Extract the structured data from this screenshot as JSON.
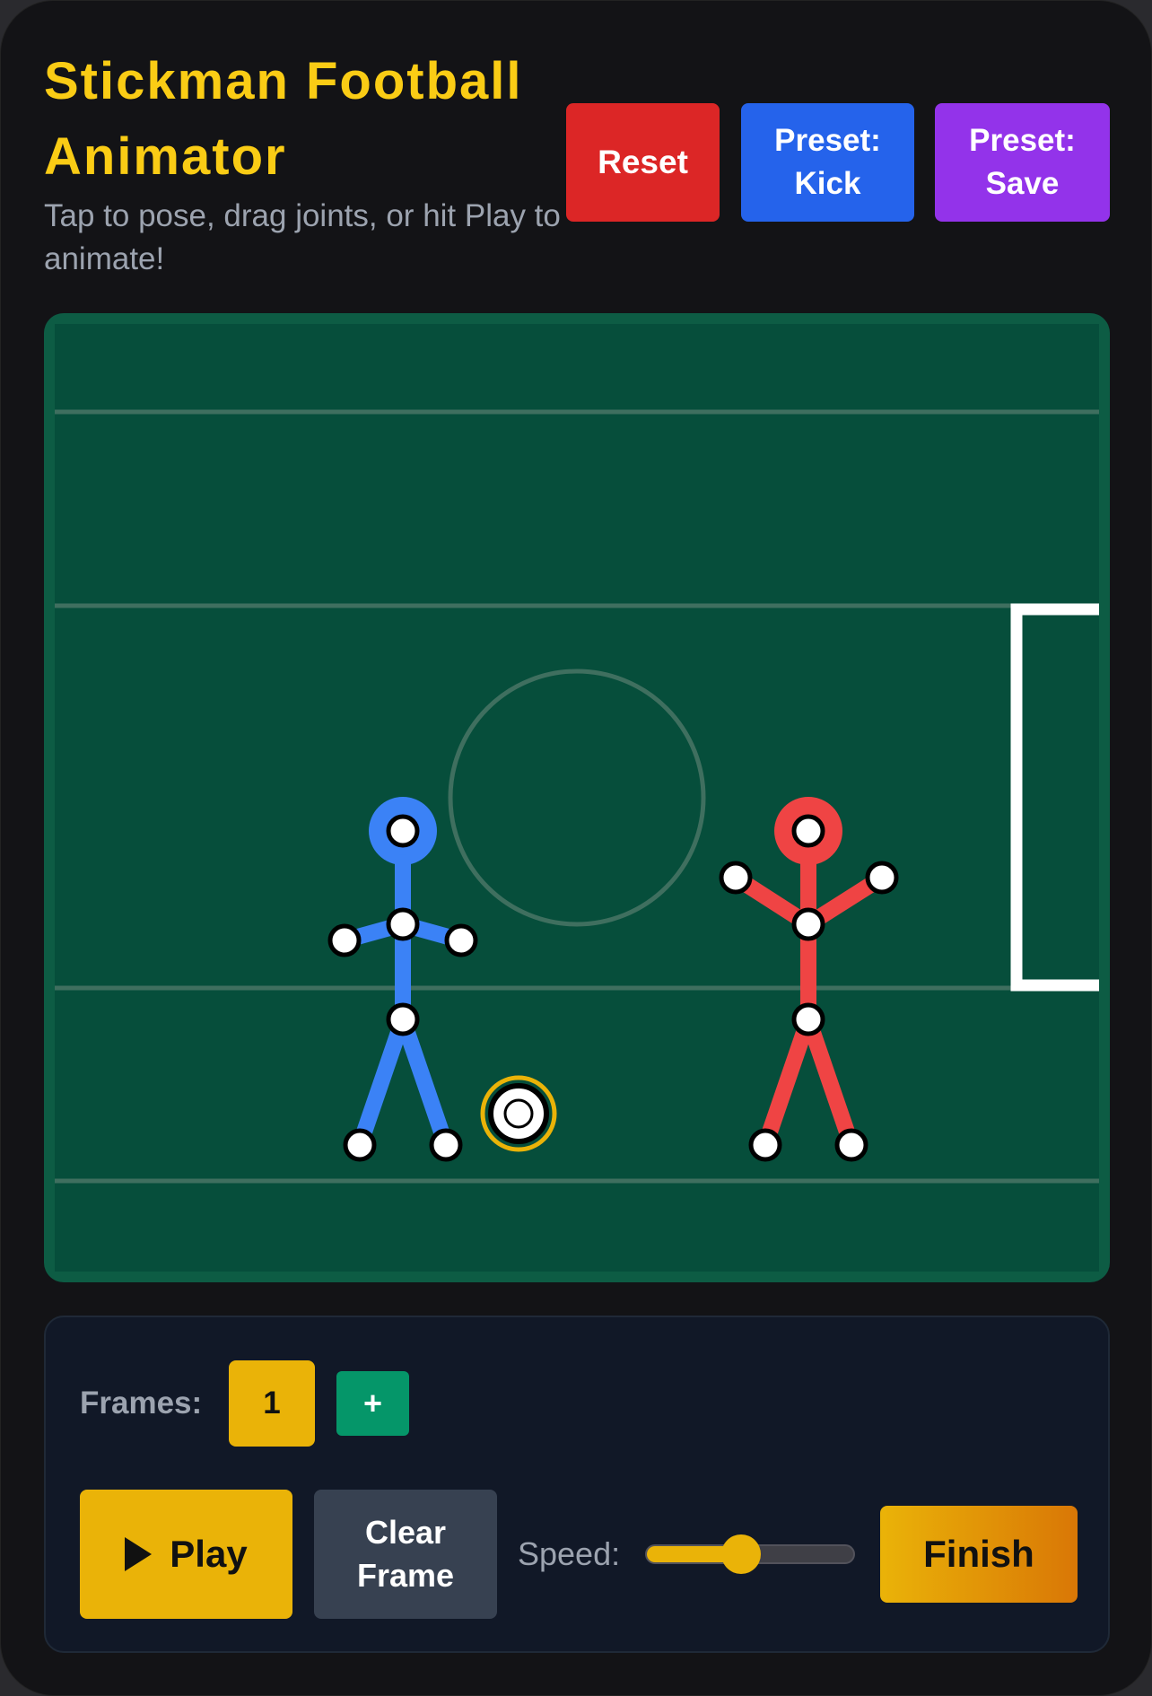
{
  "header": {
    "title": "Stickman Football Animator",
    "subtitle": "Tap to pose, drag joints, or hit Play to animate!"
  },
  "toolbar": {
    "reset_label": "Reset",
    "preset_kick_label": "Preset: Kick",
    "preset_save_label": "Preset: Save"
  },
  "colors": {
    "accent": "#facc15",
    "field": "#064e3b",
    "player_blue": "#3b82f6",
    "player_red": "#ef4444"
  },
  "field": {
    "players": [
      {
        "name": "blue-stickman",
        "color": "#3b82f6"
      },
      {
        "name": "red-stickman",
        "color": "#ef4444"
      }
    ],
    "ball": "soccer-ball",
    "goal": "goal"
  },
  "timeline": {
    "frames_label": "Frames:",
    "frames": [
      "1"
    ],
    "add_frame_label": "+",
    "play_label": "Play",
    "clear_frame_label": "Clear Frame",
    "speed_label": "Speed:",
    "speed_fraction": 0.45,
    "finish_label": "Finish"
  }
}
